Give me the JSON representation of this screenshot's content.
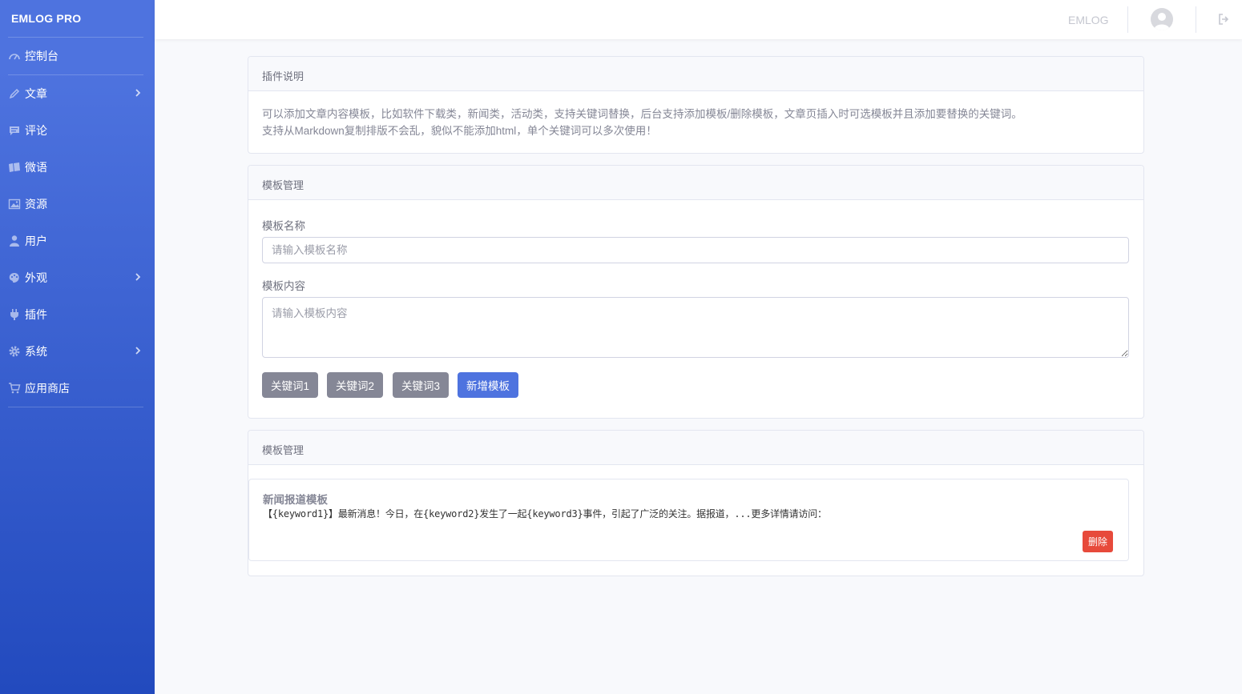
{
  "sidebar": {
    "brand": "EMLOG PRO",
    "items": [
      {
        "label": "控制台",
        "icon": "dashboard-icon",
        "has_submenu": false
      },
      {
        "label": "文章",
        "icon": "pencil-icon",
        "has_submenu": true
      },
      {
        "label": "评论",
        "icon": "comment-icon",
        "has_submenu": false
      },
      {
        "label": "微语",
        "icon": "note-icon",
        "has_submenu": false
      },
      {
        "label": "资源",
        "icon": "image-icon",
        "has_submenu": false
      },
      {
        "label": "用户",
        "icon": "user-icon",
        "has_submenu": false
      },
      {
        "label": "外观",
        "icon": "palette-icon",
        "has_submenu": true
      },
      {
        "label": "插件",
        "icon": "plug-icon",
        "has_submenu": false
      },
      {
        "label": "系统",
        "icon": "gear-icon",
        "has_submenu": true
      },
      {
        "label": "应用商店",
        "icon": "cart-icon",
        "has_submenu": false
      }
    ]
  },
  "topbar": {
    "site_name": "EMLOG"
  },
  "plugin_info": {
    "header": "插件说明",
    "line1": "可以添加文章内容模板，比如软件下载类，新闻类，活动类，支持关键词替换，后台支持添加模板/删除模板，文章页插入时可选模板并且添加要替换的关键词。",
    "line2": "支持从Markdown复制排版不会乱，貌似不能添加html，单个关键词可以多次使用！"
  },
  "template_form": {
    "header": "模板管理",
    "name_label": "模板名称",
    "name_placeholder": "请输入模板名称",
    "content_label": "模板内容",
    "content_placeholder": "请输入模板内容",
    "keyword_buttons": [
      "关键词1",
      "关键词2",
      "关键词3"
    ],
    "add_button": "新增模板"
  },
  "template_list": {
    "header": "模板管理",
    "items": [
      {
        "title": "新闻报道模板",
        "content": "【{keyword1}】最新消息！今日，在{keyword2}发生了一起{keyword3}事件，引起了广泛的关注。据报道，...更多详情请访问：",
        "delete_label": "删除"
      }
    ]
  },
  "colors": {
    "primary": "#4e73df",
    "sidebar_bottom": "#224abe",
    "danger": "#e74a3b",
    "secondary": "#858796"
  }
}
